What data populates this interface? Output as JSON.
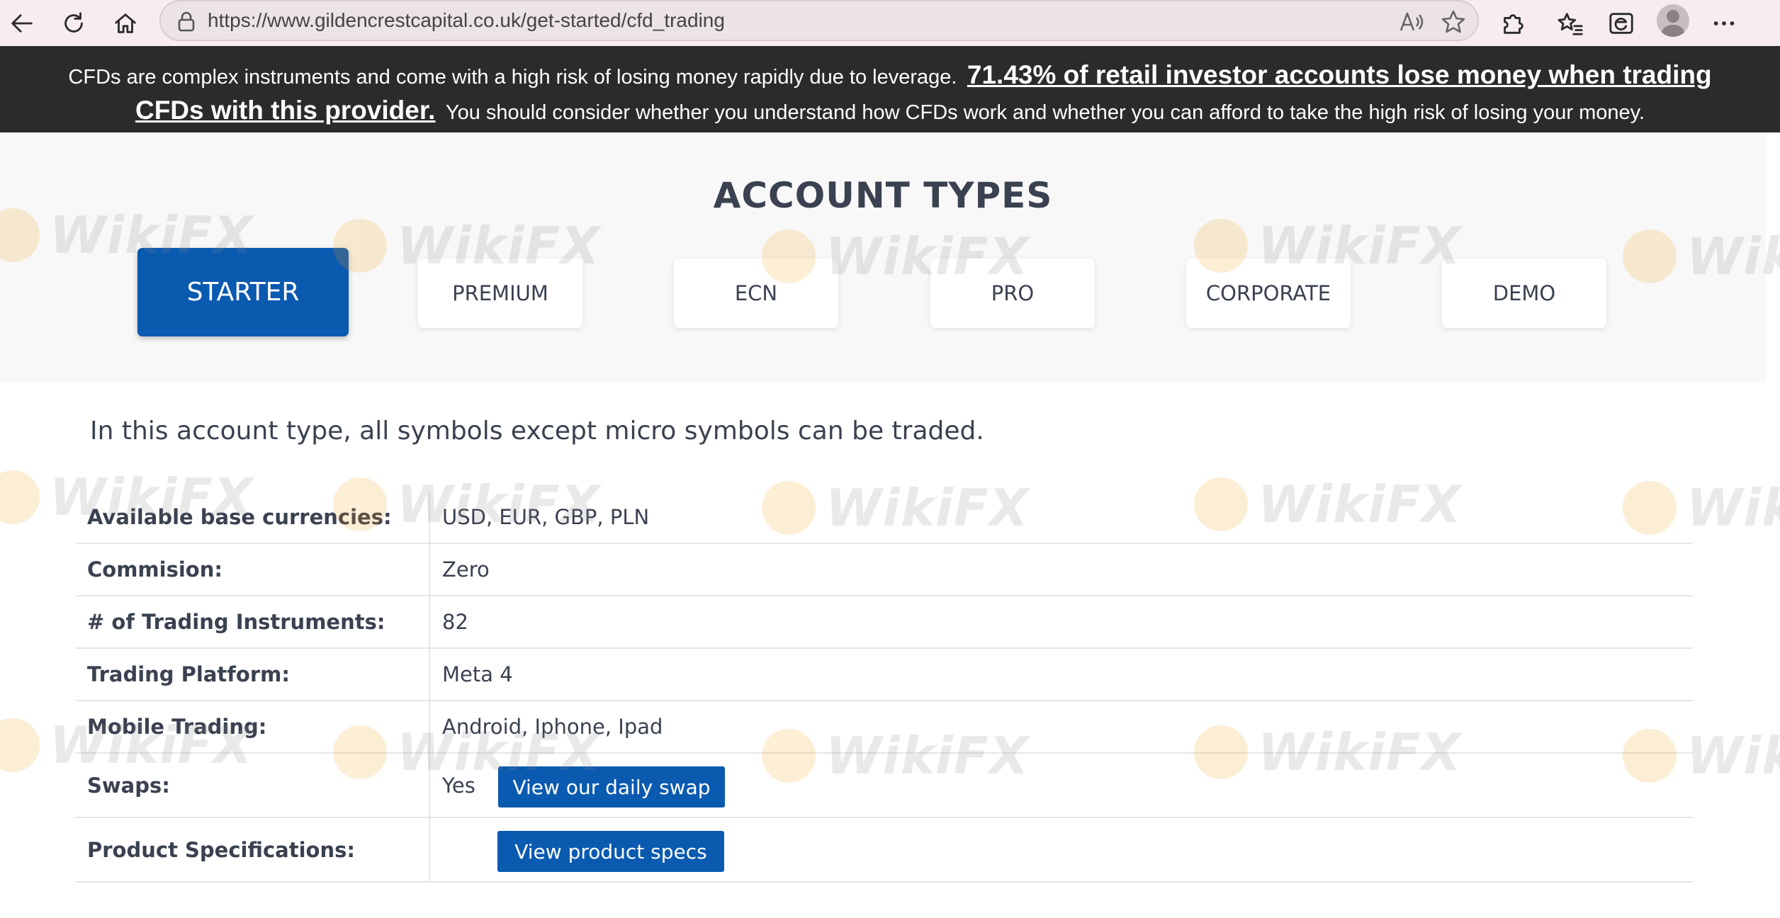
{
  "browser": {
    "url": "https://www.gildencrestcapital.co.uk/get-started/cfd_trading"
  },
  "risk_banner": {
    "text_before": "CFDs are complex instruments and come with a high risk of losing money rapidly due to leverage.",
    "highlight": "71.43% of retail investor accounts lose money when trading CFDs with this provider.",
    "text_after": "You should consider whether you understand how CFDs work and whether you can afford to take the high risk of losing your money."
  },
  "account_types": {
    "title": "ACCOUNT TYPES",
    "tabs": [
      {
        "label": "STARTER",
        "active": true
      },
      {
        "label": "PREMIUM",
        "active": false
      },
      {
        "label": "ECN",
        "active": false
      },
      {
        "label": "PRO",
        "active": false
      },
      {
        "label": "CORPORATE",
        "active": false
      },
      {
        "label": "DEMO",
        "active": false
      }
    ]
  },
  "details": {
    "intro": "In this account type, all symbols except micro symbols can be traded.",
    "rows": [
      {
        "label": "Available base currencies:",
        "value": "USD, EUR, GBP, PLN"
      },
      {
        "label": "Commision:",
        "value": "Zero"
      },
      {
        "label": "# of Trading Instruments:",
        "value": "82"
      },
      {
        "label": "Trading Platform:",
        "value": "Meta 4"
      },
      {
        "label": "Mobile Trading:",
        "value": "Android, Iphone, Ipad"
      },
      {
        "label": "Swaps:",
        "value": "Yes",
        "button": "View our daily swap"
      },
      {
        "label": "Product Specifications:",
        "value": "",
        "button": "View product specs"
      }
    ]
  },
  "watermark": {
    "text": "WikiFX",
    "logo_color": "#f2a21b"
  },
  "colors": {
    "primary": "#0a5ab0",
    "banner_bg": "#2b2b2b",
    "section_bg": "#f8f8f8",
    "text": "#3a4150"
  }
}
